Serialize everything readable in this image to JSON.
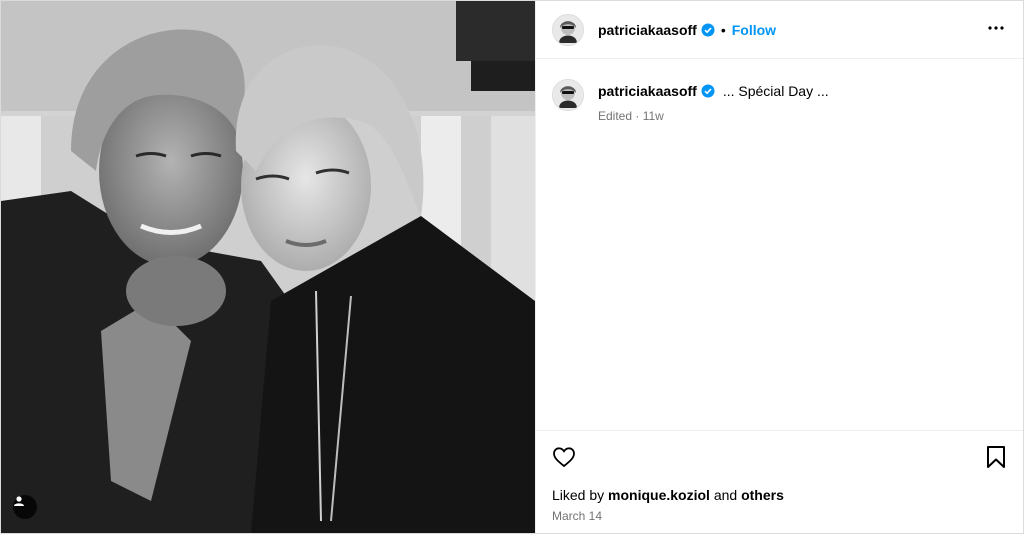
{
  "post": {
    "username": "patriciakaasoff",
    "follow_label": "Follow",
    "separator": "•",
    "caption": "... Spécial Day ...",
    "edited_label": "Edited",
    "meta_separator": "·",
    "age": "11w",
    "liked_by_prefix": "Liked by",
    "liked_by_user": "monique.koziol",
    "liked_by_and": "and",
    "liked_by_others": "others",
    "date": "March 14"
  },
  "icons": {
    "verified": "verified-badge-icon",
    "more": "more-options-icon",
    "like": "heart-icon",
    "save": "bookmark-icon",
    "tag": "user-tag-icon"
  },
  "colors": {
    "accent": "#0095f6",
    "verified": "#0095f6",
    "muted": "#737373",
    "border": "#dbdbdb"
  }
}
